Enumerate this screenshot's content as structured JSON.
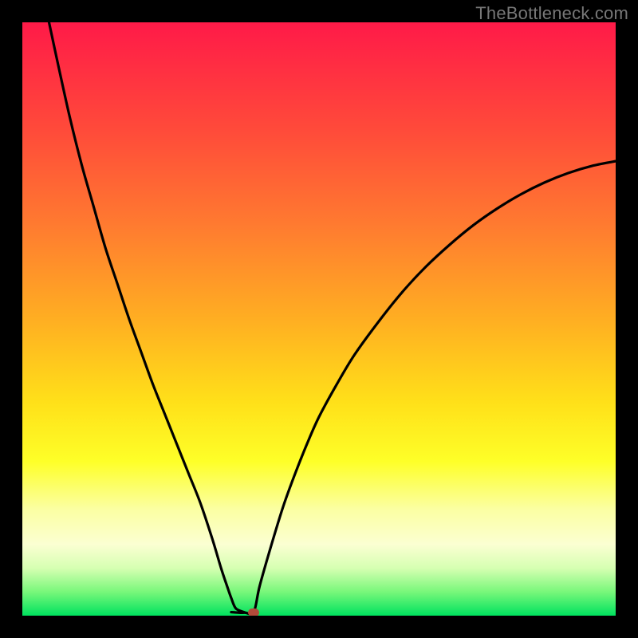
{
  "watermark": "TheBottleneck.com",
  "colors": {
    "frame": "#000000",
    "curve": "#000000",
    "marker": "#b24a3a",
    "gradient_top": "#ff1a48",
    "gradient_bottom": "#00e25f"
  },
  "chart_data": {
    "type": "line",
    "title": "",
    "xlabel": "",
    "ylabel": "",
    "xlim": [
      0,
      100
    ],
    "ylim": [
      0,
      100
    ],
    "grid": false,
    "legend": false,
    "series": [
      {
        "name": "left-branch",
        "x": [
          4.5,
          6,
          8,
          10,
          12,
          14,
          16,
          18,
          20,
          22,
          24,
          26,
          28,
          30,
          32,
          33.5,
          34.5,
          35.2,
          36.0,
          37.5
        ],
        "y": [
          100,
          93,
          84,
          76,
          69,
          62,
          56,
          50,
          44.5,
          39,
          34,
          29,
          24,
          19,
          13,
          8,
          5,
          3,
          1.2,
          0.5
        ]
      },
      {
        "name": "flat-bottom",
        "x": [
          35.2,
          37.5,
          39.0
        ],
        "y": [
          0.6,
          0.5,
          0.6
        ]
      },
      {
        "name": "right-branch",
        "x": [
          39.0,
          40,
          42,
          44,
          46,
          48,
          50,
          53,
          56,
          60,
          64,
          68,
          72,
          76,
          80,
          84,
          88,
          92,
          96,
          100
        ],
        "y": [
          0.6,
          5,
          12,
          18.5,
          24,
          29,
          33.5,
          39,
          44,
          49.5,
          54.5,
          58.8,
          62.5,
          65.8,
          68.6,
          71,
          73,
          74.6,
          75.8,
          76.6
        ]
      }
    ],
    "marker": {
      "x": 39.0,
      "y": 0.6
    },
    "gradient_stops": [
      {
        "pos": 0.0,
        "color": "#ff1a48"
      },
      {
        "pos": 0.18,
        "color": "#ff4a3a"
      },
      {
        "pos": 0.34,
        "color": "#ff7a30"
      },
      {
        "pos": 0.5,
        "color": "#ffae22"
      },
      {
        "pos": 0.64,
        "color": "#ffe019"
      },
      {
        "pos": 0.74,
        "color": "#feff28"
      },
      {
        "pos": 0.82,
        "color": "#fbffa2"
      },
      {
        "pos": 0.88,
        "color": "#fbffd2"
      },
      {
        "pos": 0.92,
        "color": "#d6ffb2"
      },
      {
        "pos": 0.96,
        "color": "#78f77a"
      },
      {
        "pos": 1.0,
        "color": "#00e25f"
      }
    ]
  }
}
